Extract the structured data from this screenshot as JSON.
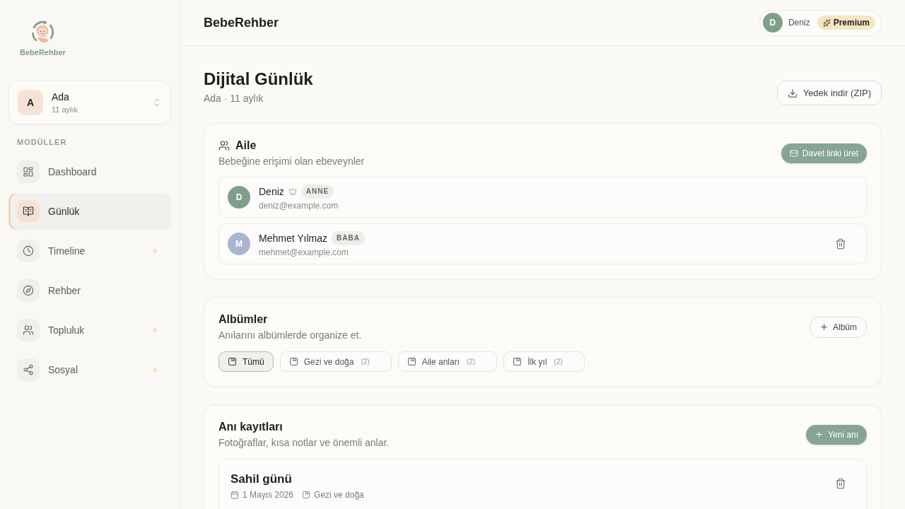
{
  "sidebar": {
    "logo": {
      "text": "BebeRehber"
    },
    "child_selector": {
      "initial": "A",
      "name": "Ada",
      "age": "11 aylık"
    },
    "section_label": "MODÜLLER",
    "items": [
      {
        "label": "Dashboard",
        "selected": false,
        "dot": false
      },
      {
        "label": "Günlük",
        "selected": true,
        "dot": false
      },
      {
        "label": "Timeline",
        "selected": false,
        "dot": true
      },
      {
        "label": "Rehber",
        "selected": false,
        "dot": false
      },
      {
        "label": "Topluluk",
        "selected": false,
        "dot": true
      },
      {
        "label": "Sosyal",
        "selected": false,
        "dot": true
      }
    ]
  },
  "header": {
    "title": "BebeRehber",
    "user": {
      "initial": "D",
      "name": "Deniz",
      "plan": "Premium"
    }
  },
  "page": {
    "title": "Dijital Günlük",
    "subtitle": "Ada · 11 aylık",
    "backup_button": "Yedek indir (ZIP)"
  },
  "family": {
    "title": "Aile",
    "subtitle": "Bebeğine erişimi olan ebeveynler",
    "invite_button": "Davet linki üret",
    "members": [
      {
        "initial": "D",
        "name": "Deniz",
        "owner": true,
        "role": "ANNE",
        "email": "deniz@example.com",
        "color": "#809f8a",
        "deletable": false
      },
      {
        "initial": "M",
        "name": "Mehmet Yılmaz",
        "owner": false,
        "role": "BABA",
        "email": "mehmet@example.com",
        "color": "#a9b6cf",
        "deletable": true
      }
    ]
  },
  "albums": {
    "title": "Albümler",
    "subtitle": "Anılarını albümlerde organize et.",
    "add_button": "Albüm",
    "filters": [
      {
        "label": "Tümü",
        "selected": true
      },
      {
        "label": "Gezi ve doğa",
        "count": "(2)",
        "selected": false
      },
      {
        "label": "Aile anları",
        "count": "(2)",
        "selected": false
      },
      {
        "label": "İlk yıl",
        "count": "(2)",
        "selected": false
      }
    ]
  },
  "memories": {
    "title": "Anı kayıtları",
    "subtitle": "Fotoğraflar, kısa notlar ve önemli anlar.",
    "add_button": "Yeni anı",
    "entries": [
      {
        "title": "Sahil günü",
        "date": "1 Mayıs 2026",
        "album": "Gezi ve doğa",
        "deletable": true
      }
    ]
  }
}
